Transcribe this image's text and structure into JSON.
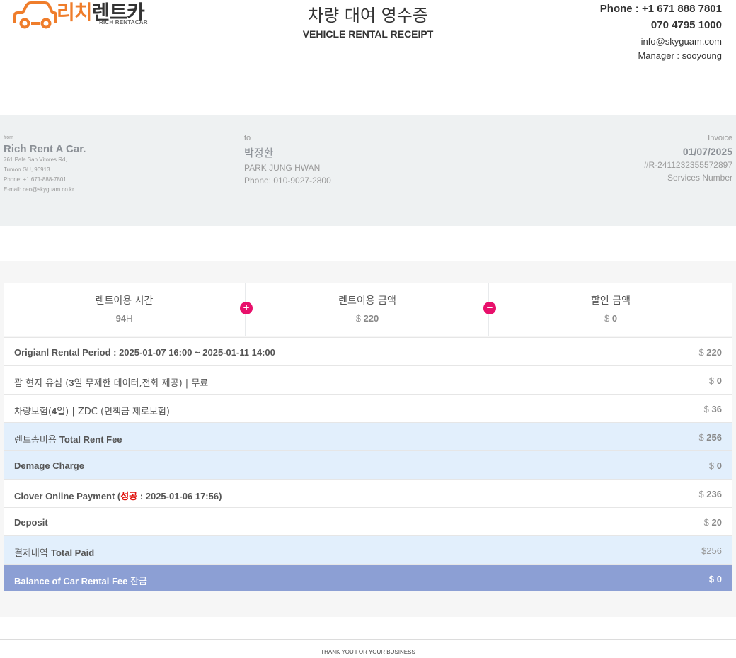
{
  "brand": {
    "logo_ko_highlight": "리치",
    "logo_ko_rest": "렌트카",
    "logo_en": "RICH RENTACAR",
    "accent": "#ef7d2b"
  },
  "title": {
    "ko": "차량 대여 영수증",
    "en": "VEHICLE RENTAL RECEIPT"
  },
  "contact": {
    "phone": "Phone : +1 671 888 7801",
    "phone2": "070 4795 1000",
    "email": "info@skyguam.com",
    "manager": "Manager : sooyoung"
  },
  "from": {
    "label": "from",
    "name": "Rich Rent A Car.",
    "address1": "761 Pale San Vitores Rd,",
    "address2": "Tumon GU, 96913",
    "phone": "Phone: +1 671-888-7801",
    "email": "E-mail: ceo@skyguam.co.kr"
  },
  "to": {
    "label": "to",
    "name_ko": "박정환",
    "name_en": "PARK JUNG HWAN",
    "phone": "Phone: 010-9027-2800"
  },
  "invoice": {
    "label": "Invoice",
    "date": "01/07/2025",
    "number": "#R-2411232355572897",
    "services_label": "Services Number"
  },
  "summary": {
    "time": {
      "label": "렌트이용 시간",
      "value": "94",
      "unit": "H"
    },
    "fee": {
      "label": "렌트이용 금액",
      "currency": "$",
      "value": "220"
    },
    "discount": {
      "label": "할인 금액",
      "currency": "$",
      "value": "0"
    },
    "plus_icon": "+",
    "minus_icon": "−",
    "icon_color": "#e8106b"
  },
  "rows": [
    {
      "label": "Origianl Rental Period : 2025-01-07 16:00 ~ 2025-01-11 14:00",
      "currency": "$",
      "amount": "220"
    },
    {
      "label_ko": "괌 현지 유심 (",
      "label_mid": "3",
      "label_ko2": "일 무제한 데이터,전화 제공) | 무료",
      "currency": "$",
      "amount": "0"
    },
    {
      "label_ko": "차량보험(",
      "label_mid": "4",
      "label_ko2": "일) | ZDC (면책금 제로보험)",
      "currency": "$",
      "amount": "36"
    },
    {
      "label_ko": "렌트총비용 ",
      "label_en": "Total Rent Fee",
      "currency": "$",
      "amount": "256"
    },
    {
      "label": "Demage Charge",
      "currency": "$",
      "amount": "0"
    },
    {
      "label_pre": "Clover Online Payment (",
      "label_red": "성공",
      "label_post": " : 2025-01-06 17:56)",
      "currency": "$",
      "amount": "236"
    },
    {
      "label": "Deposit",
      "currency": "$",
      "amount": "20"
    },
    {
      "label_ko": "결제내역 ",
      "label_en": "Total Paid",
      "amount_text": "$256"
    },
    {
      "label_en": "Balance of Car Rental Fee ",
      "label_ko": "잔금",
      "currency": "$",
      "amount": "0"
    }
  ],
  "footer": "THANK YOU FOR YOUR BUSINESS"
}
